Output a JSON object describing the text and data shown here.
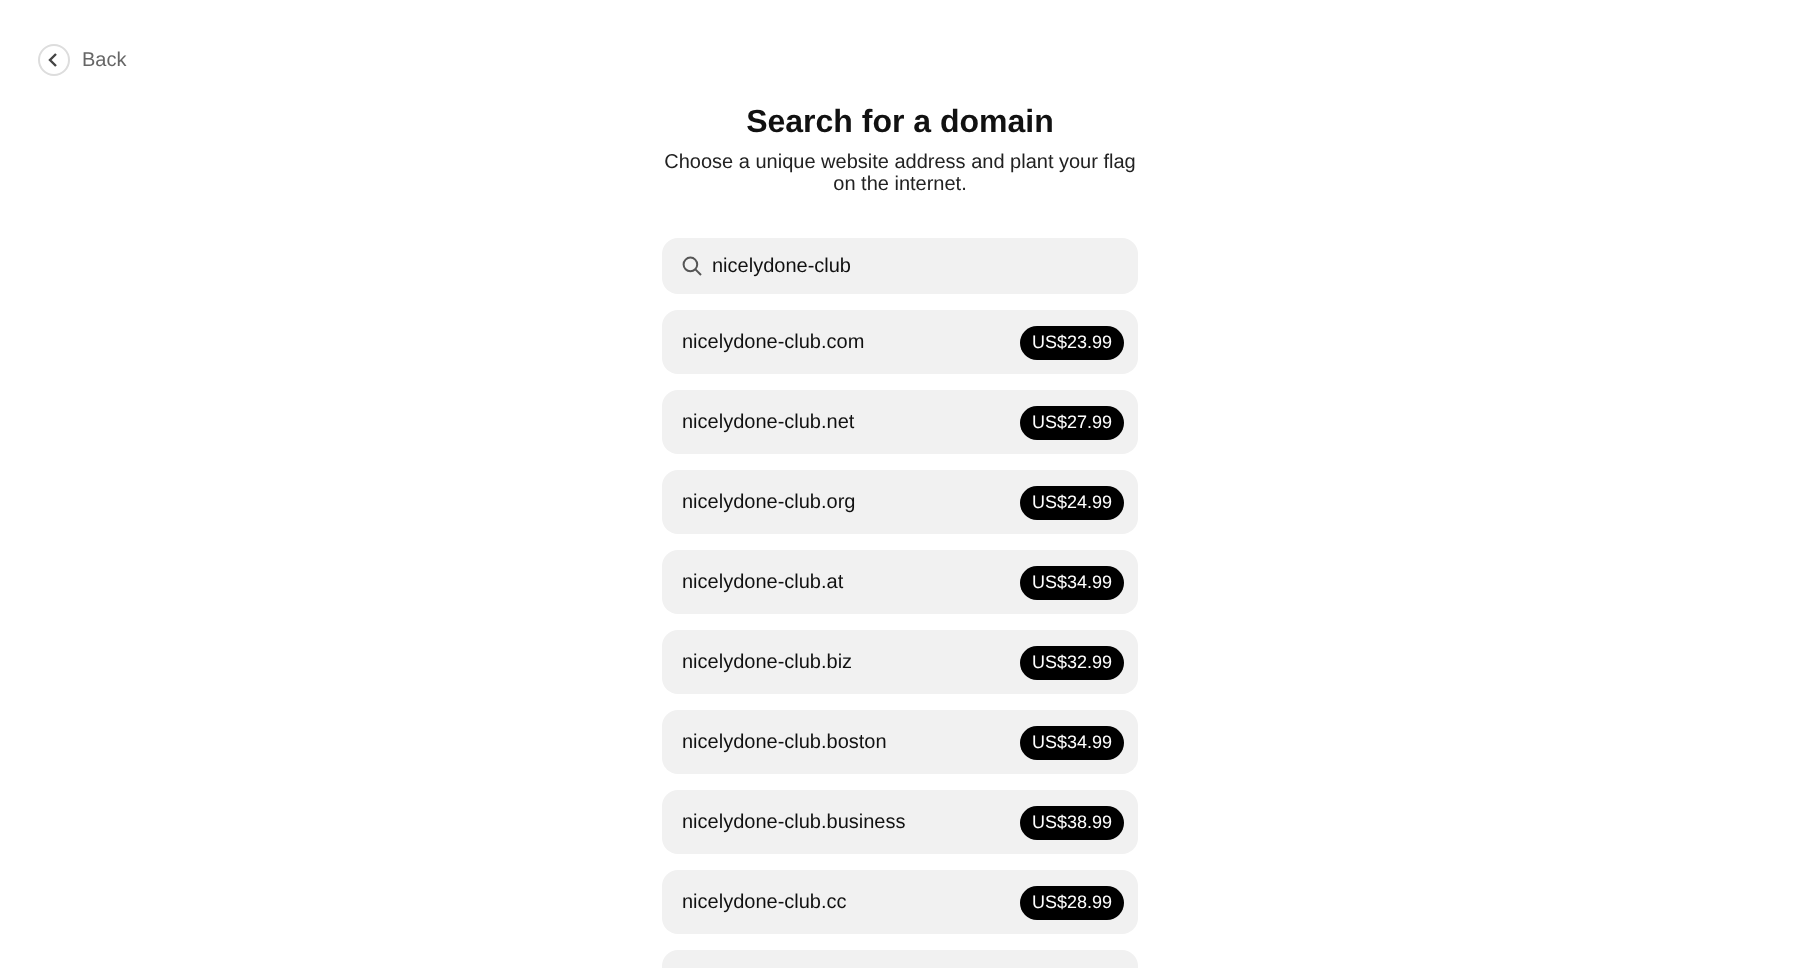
{
  "back": {
    "label": "Back"
  },
  "title": "Search for a domain",
  "subtitle": "Choose a unique website address and plant your flag on the internet.",
  "search": {
    "value": "nicelydone-club"
  },
  "results": [
    {
      "domain": "nicelydone-club.com",
      "price": "US$23.99"
    },
    {
      "domain": "nicelydone-club.net",
      "price": "US$27.99"
    },
    {
      "domain": "nicelydone-club.org",
      "price": "US$24.99"
    },
    {
      "domain": "nicelydone-club.at",
      "price": "US$34.99"
    },
    {
      "domain": "nicelydone-club.biz",
      "price": "US$32.99"
    },
    {
      "domain": "nicelydone-club.boston",
      "price": "US$34.99"
    },
    {
      "domain": "nicelydone-club.business",
      "price": "US$38.99"
    },
    {
      "domain": "nicelydone-club.cc",
      "price": "US$28.99"
    }
  ]
}
